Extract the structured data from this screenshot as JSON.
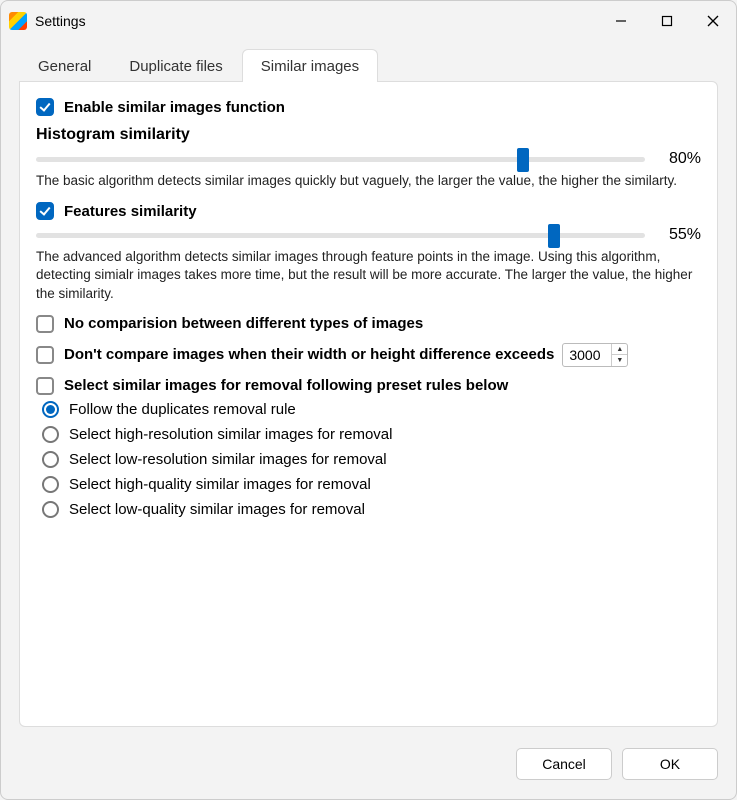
{
  "window": {
    "title": "Settings"
  },
  "tabs": {
    "general": "General",
    "duplicates": "Duplicate files",
    "similar": "Similar images",
    "active": "similar"
  },
  "enableSimilar": {
    "label": "Enable similar images function",
    "checked": true
  },
  "histogram": {
    "title": "Histogram similarity",
    "value": 80,
    "valueText": "80%",
    "description": "The basic algorithm detects similar images quickly but vaguely, the larger the value, the higher the similarty."
  },
  "features": {
    "label": "Features similarity",
    "checked": true,
    "value": 55,
    "valueText": "55%",
    "description": "The advanced algorithm detects similar images through feature points in the image. Using this algorithm, detecting simialr images takes more time, but the result will be more accurate. The larger the value, the higher the similarity."
  },
  "noCompareTypes": {
    "label": "No comparision between different types of images",
    "checked": false
  },
  "sizeDiff": {
    "label": "Don't compare images when their width or height difference exceeds",
    "checked": false,
    "value": "3000"
  },
  "presetRules": {
    "label": "Select similar images for removal following preset rules below",
    "checked": false,
    "selected": 0,
    "options": [
      "Follow the duplicates removal rule",
      "Select high-resolution similar images for removal",
      "Select low-resolution similar images for removal",
      "Select high-quality similar images for removal",
      "Select low-quality similar images for removal"
    ]
  },
  "footer": {
    "cancel": "Cancel",
    "ok": "OK"
  }
}
